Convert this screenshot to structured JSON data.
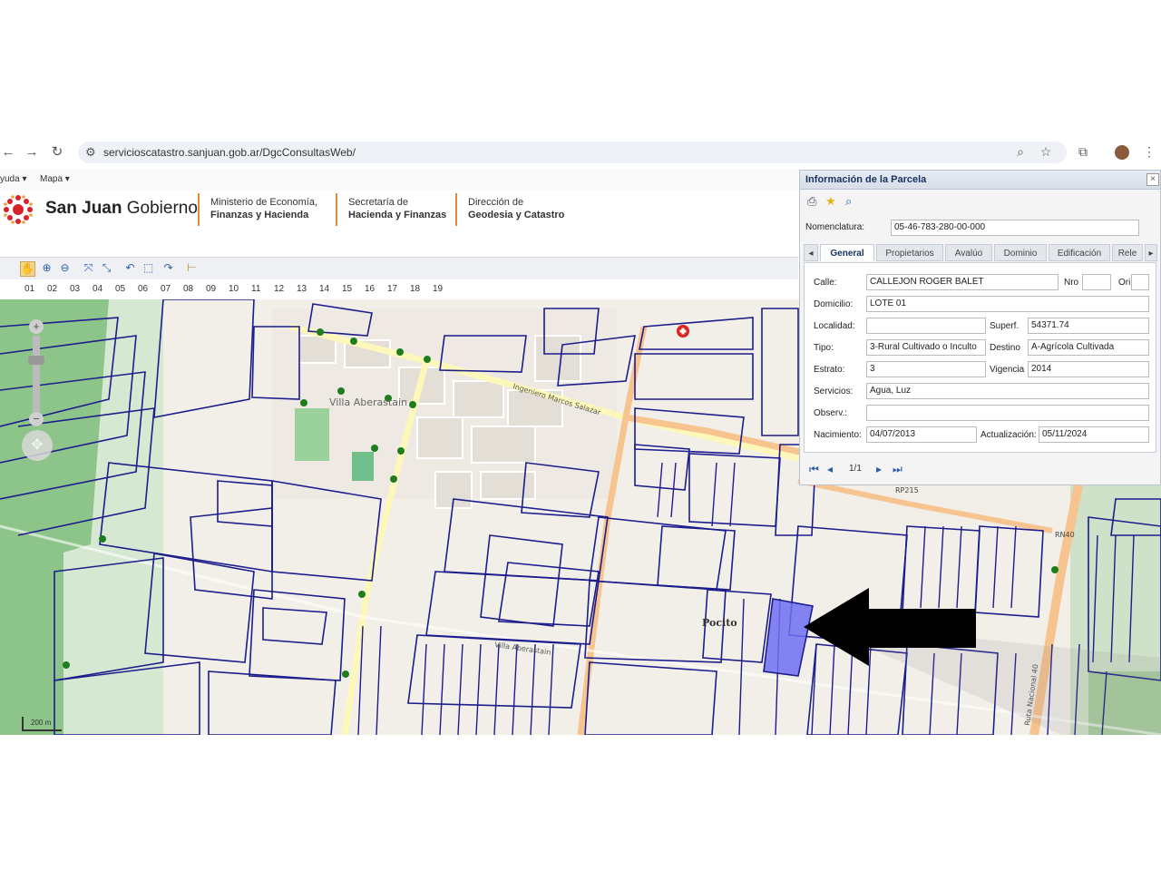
{
  "browser": {
    "url": "servicioscatastro.sanjuan.gob.ar/DgcConsultasWeb/"
  },
  "menu": {
    "items": [
      "yuda ▾",
      "Mapa ▾"
    ]
  },
  "header": {
    "brand_bold": "San Juan",
    "brand_rest": "Gobierno",
    "ministry_line1": "Ministerio de Economía,",
    "ministry_line2": "Finanzas y Hacienda",
    "secretaria_line1": "Secretaría de",
    "secretaria_line2": "Hacienda y Finanzas",
    "direccion_line1": "Dirección de",
    "direccion_line2": "Geodesia y Catastro"
  },
  "ruler": [
    "01",
    "02",
    "03",
    "04",
    "05",
    "06",
    "07",
    "08",
    "09",
    "10",
    "11",
    "12",
    "13",
    "14",
    "15",
    "16",
    "17",
    "18",
    "19"
  ],
  "map": {
    "labels": {
      "villa": "Villa Aberastain",
      "pocito": "Pocito",
      "road_rp215": "RP215",
      "road_rn40": "RN40",
      "street_salazar": "Ingeniero Marcos Salazar",
      "street_aberastain": "Villa Aberastain",
      "ruta_nacional": "Ruta Nacional 40",
      "scale": "200 m"
    }
  },
  "panel": {
    "title": "Información de la Parcela",
    "nomenclatura_label": "Nomenclatura:",
    "nomenclatura_value": "05-46-783-280-00-000",
    "tabs": [
      "General",
      "Propietarios",
      "Avalúo",
      "Dominio",
      "Edificación",
      "Rele"
    ],
    "fields": {
      "calle_label": "Calle:",
      "calle_value": "CALLEJON ROGER BALET",
      "nro_label": "Nro",
      "nro_value": "",
      "ori_label": "Ori",
      "ori_value": "",
      "domicilio_label": "Domicilio:",
      "domicilio_value": "LOTE 01",
      "localidad_label": "Localidad:",
      "localidad_value": "",
      "superf_label": "Superf.",
      "superf_value": "54371.74",
      "tipo_label": "Tipo:",
      "tipo_value": "3-Rural Cultivado o Inculto",
      "destino_label": "Destino",
      "destino_value": "A-Agrícola Cultivada",
      "estrato_label": "Estrato:",
      "estrato_value": "3",
      "vigencia_label": "Vigencia",
      "vigencia_value": "2014",
      "servicios_label": "Servicios:",
      "servicios_value": "Agua, Luz",
      "observ_label": "Observ.:",
      "observ_value": "",
      "nacimiento_label": "Nacimiento:",
      "nacimiento_value": "04/07/2013",
      "actualizacion_label": "Actualización:",
      "actualizacion_value": "05/11/2024"
    },
    "pager": "1/1"
  }
}
